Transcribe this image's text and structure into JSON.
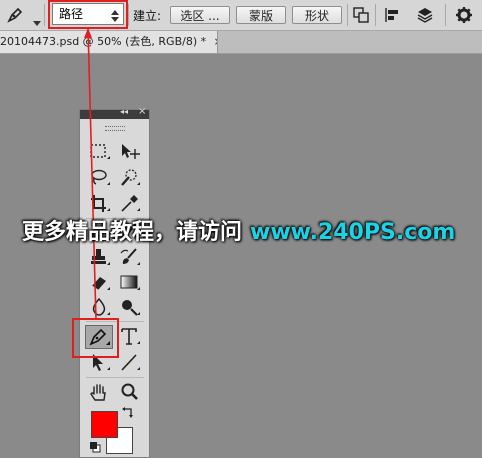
{
  "options_bar": {
    "mode_value": "路径",
    "build_label": "建立:",
    "selection_button": "选区 ...",
    "mask_button": "蒙版",
    "shape_button": "形状"
  },
  "document_tab": {
    "title": "20104473.psd @ 50% (去色, RGB/8) *",
    "close_symbol": "×"
  },
  "toolbox": {
    "collapse_symbol": "◂◂",
    "close_symbol": "×"
  },
  "colors": {
    "foreground": "#ff0000",
    "background": "#ffffff",
    "annotation": "#e02020",
    "watermark_url": "#1ad3e6"
  },
  "watermark": {
    "text": "更多精品教程，请访问",
    "url": "www.240PS.com"
  },
  "icons": [
    "pen-icon",
    "dropdown-arrow-icon",
    "combine-paths-icon",
    "align-icon",
    "arrange-icon",
    "gear-icon",
    "marquee-icon",
    "move-icon",
    "lasso-icon",
    "quick-select-icon",
    "crop-icon",
    "eyedropper-icon",
    "healing-brush-icon",
    "brush-icon",
    "clone-stamp-icon",
    "history-brush-icon",
    "eraser-icon",
    "gradient-icon",
    "blur-icon",
    "dodge-icon",
    "pen-tool-icon",
    "type-icon",
    "path-select-icon",
    "line-icon",
    "hand-icon",
    "zoom-icon",
    "swap-colors-icon",
    "default-colors-icon"
  ]
}
